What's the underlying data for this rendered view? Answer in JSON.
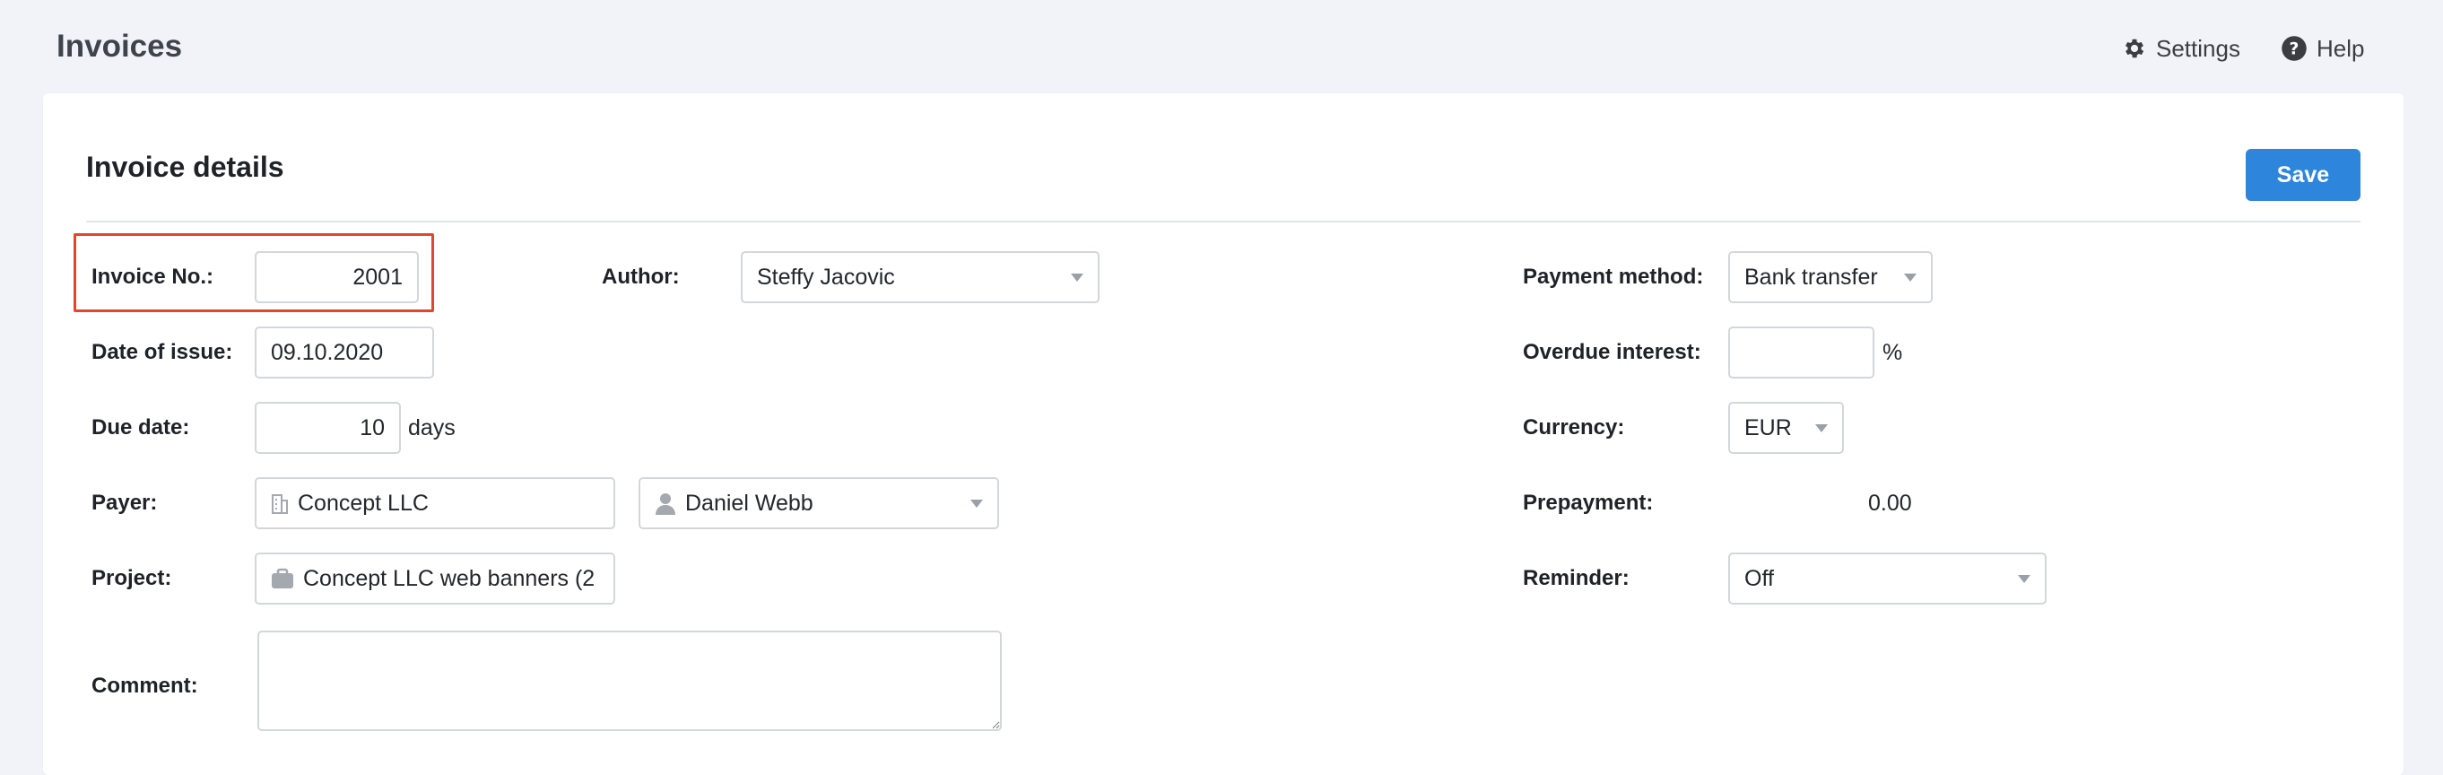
{
  "header": {
    "title": "Invoices",
    "settings_label": "Settings",
    "help_label": "Help"
  },
  "card": {
    "title": "Invoice details",
    "save_label": "Save"
  },
  "form": {
    "invoice_no": {
      "label": "Invoice No.:",
      "value": "2001"
    },
    "date_of_issue": {
      "label": "Date of issue:",
      "value": "09.10.2020"
    },
    "due_date": {
      "label": "Due date:",
      "value": "10",
      "suffix": "days"
    },
    "payer": {
      "label": "Payer:",
      "company": "Concept LLC",
      "contact": "Daniel Webb"
    },
    "project": {
      "label": "Project:",
      "value": "Concept LLC web banners (2"
    },
    "comment": {
      "label": "Comment:",
      "value": ""
    },
    "author": {
      "label": "Author:",
      "value": "Steffy Jacovic"
    },
    "payment_method": {
      "label": "Payment method:",
      "value": "Bank transfer"
    },
    "overdue_interest": {
      "label": "Overdue interest:",
      "value": "",
      "suffix": "%"
    },
    "currency": {
      "label": "Currency:",
      "value": "EUR"
    },
    "prepayment": {
      "label": "Prepayment:",
      "value": "0.00"
    },
    "reminder": {
      "label": "Reminder:",
      "value": "Off"
    }
  },
  "colors": {
    "accent": "#2d86db",
    "highlight": "#e2462f",
    "background": "#f1f3f8"
  }
}
